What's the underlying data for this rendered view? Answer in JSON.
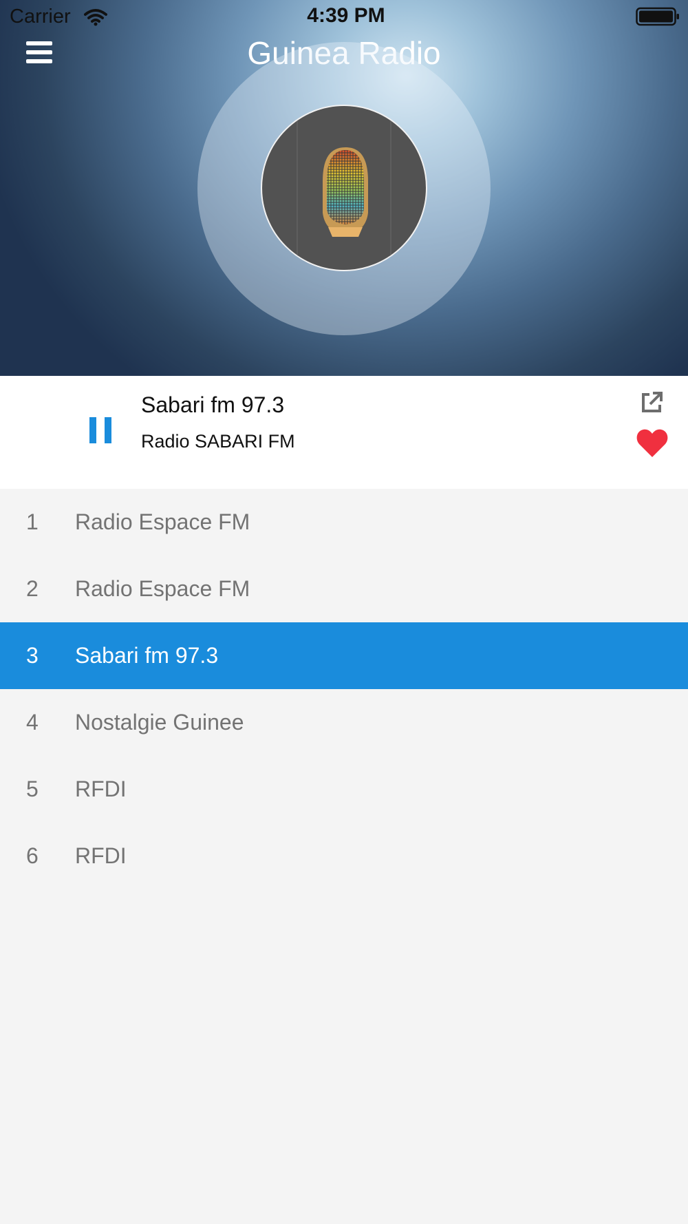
{
  "status_bar": {
    "carrier": "Carrier",
    "time": "4:39 PM"
  },
  "header": {
    "title": "Guinea Radio",
    "menu_icon": "hamburger-menu-icon"
  },
  "now_playing": {
    "title": "Sabari fm 97.3",
    "subtitle": "Radio SABARI FM",
    "state": "playing",
    "accent_color": "#1a8cdc",
    "favorite_color": "#f0303f"
  },
  "stations": [
    {
      "number": "1",
      "name": "Radio Espace FM",
      "selected": false
    },
    {
      "number": "2",
      "name": "Radio Espace FM",
      "selected": false
    },
    {
      "number": "3",
      "name": "Sabari fm 97.3",
      "selected": true
    },
    {
      "number": "4",
      "name": "Nostalgie Guinee",
      "selected": false
    },
    {
      "number": "5",
      "name": "RFDI",
      "selected": false
    },
    {
      "number": "6",
      "name": "RFDI",
      "selected": false
    }
  ]
}
